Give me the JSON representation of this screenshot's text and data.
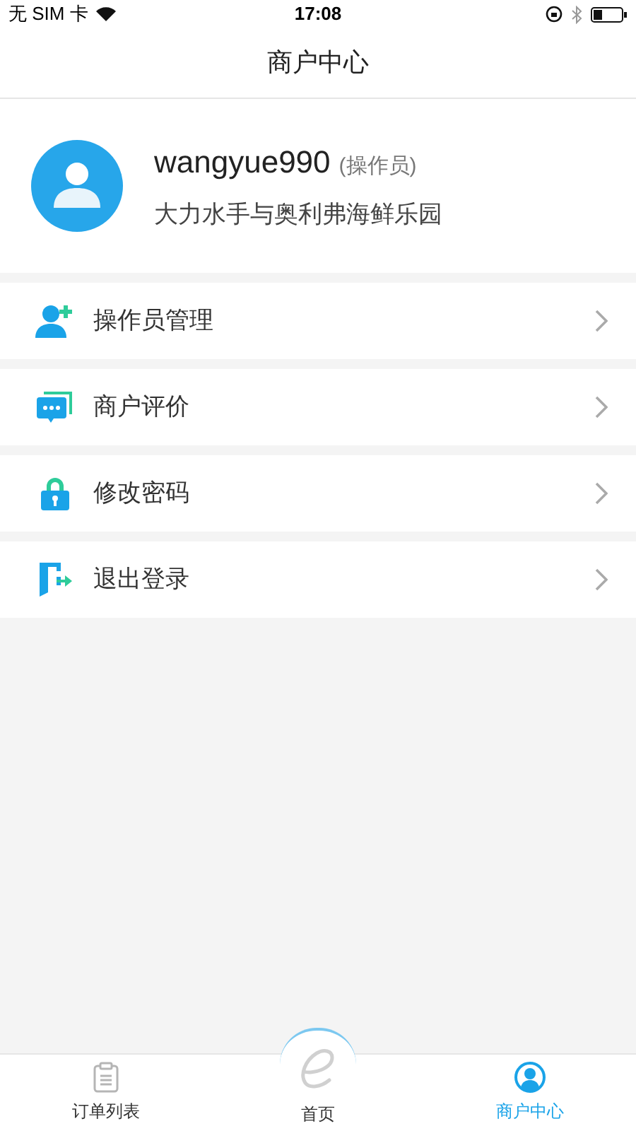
{
  "status_bar": {
    "carrier": "无 SIM 卡",
    "time": "17:08"
  },
  "nav_bar": {
    "title": "商户中心"
  },
  "profile": {
    "username": "wangyue990",
    "role": "(操作员)",
    "store": "大力水手与奥利弗海鲜乐园"
  },
  "menu": [
    {
      "kind": "operators",
      "label": "操作员管理"
    },
    {
      "kind": "reviews",
      "label": "商户评价"
    },
    {
      "kind": "password",
      "label": "修改密码"
    },
    {
      "kind": "logout",
      "label": "退出登录"
    }
  ],
  "tab_bar": [
    {
      "kind": "orders",
      "label": "订单列表",
      "selected": false
    },
    {
      "kind": "home",
      "label": "首页",
      "selected": false
    },
    {
      "kind": "merchant",
      "label": "商户中心",
      "selected": true
    }
  ]
}
